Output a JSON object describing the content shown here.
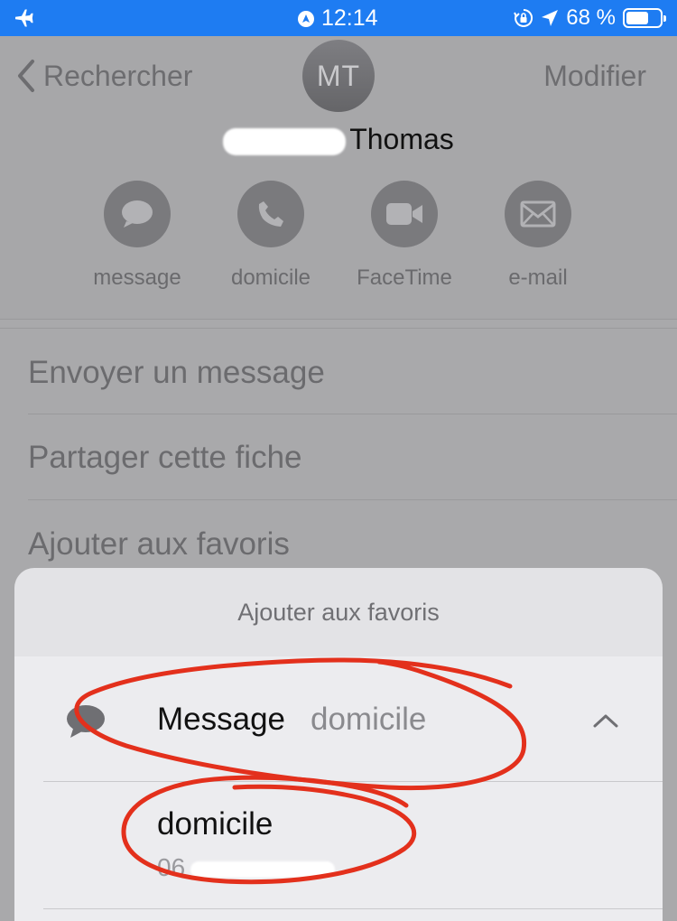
{
  "status_bar": {
    "time": "12:14",
    "battery": "68 %",
    "battery_level": 0.68,
    "icons": [
      "airplane-icon",
      "location-circle-icon",
      "orientation-lock-icon",
      "location-arrow-icon",
      "battery-icon"
    ]
  },
  "nav": {
    "back_label": "Rechercher",
    "edit_label": "Modifier"
  },
  "contact": {
    "initials": "MT",
    "name": "Thomas"
  },
  "actions": [
    {
      "label": "message",
      "icon": "message-bubble-icon"
    },
    {
      "label": "domicile",
      "icon": "phone-icon"
    },
    {
      "label": "FaceTime",
      "icon": "video-icon"
    },
    {
      "label": "e-mail",
      "icon": "mail-icon"
    }
  ],
  "list": [
    {
      "label": "Envoyer un message"
    },
    {
      "label": "Partager cette fiche"
    },
    {
      "label": "Ajouter aux favoris"
    }
  ],
  "sheet": {
    "title": "Ajouter aux favoris",
    "option": {
      "title": "Message",
      "subtitle": "domicile"
    },
    "suboption": {
      "title": "domicile",
      "number_prefix": "06"
    }
  },
  "colors": {
    "status_bar": "#1e7cf2",
    "annotation": "#e3301c"
  }
}
